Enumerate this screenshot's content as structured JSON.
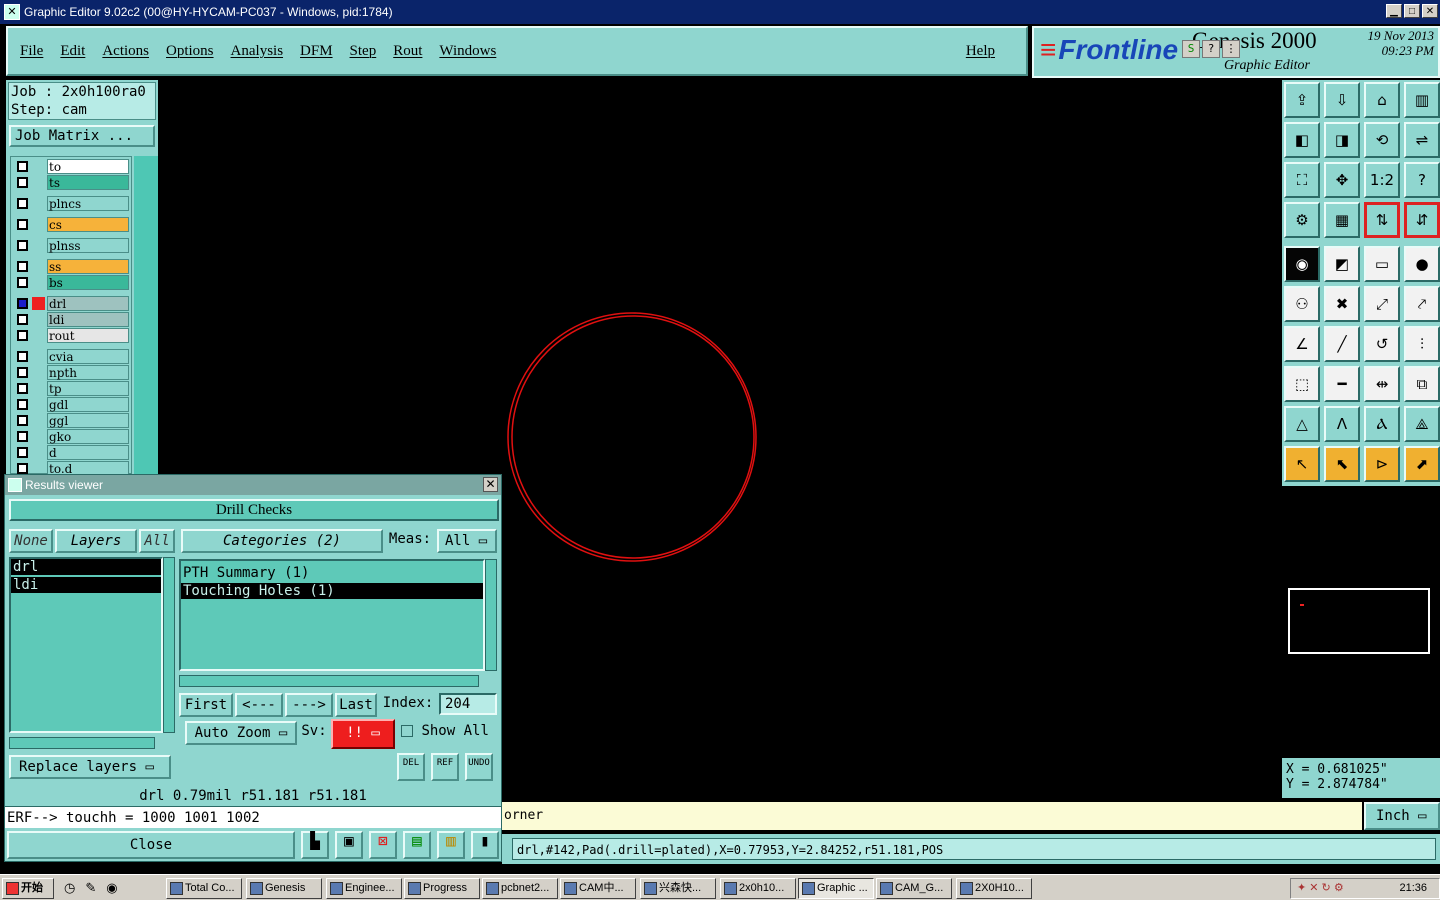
{
  "window": {
    "title": "Graphic Editor 9.02c2 (00@HY-HYCAM-PC037 - Windows, pid:1784)",
    "min": "▁",
    "max": "□",
    "close": "✕"
  },
  "menu": {
    "items": [
      "File",
      "Edit",
      "Actions",
      "Options",
      "Analysis",
      "DFM",
      "Step",
      "Rout",
      "Windows"
    ],
    "help": "Help"
  },
  "logo": {
    "brand": "Frontline",
    "product": "Genesis 2000",
    "subtitle": "Graphic Editor",
    "date": "19 Nov 2013",
    "time": "09:23 PM",
    "mini_buttons": [
      "S",
      "?",
      "⋮"
    ]
  },
  "job": {
    "job_line": "Job : 2x0h100ra0",
    "step_line": "Step: cam",
    "matrix_button": "Job Matrix ..."
  },
  "layers": [
    {
      "name": "to",
      "color": "#ffffff"
    },
    {
      "name": "ts",
      "color": "#3ab89a"
    },
    {
      "name": "plncs",
      "color": "#8fd6cf"
    },
    {
      "name": "cs",
      "color": "#f6b23a"
    },
    {
      "name": "plnss",
      "color": "#8fd6cf"
    },
    {
      "name": "ss",
      "color": "#f6b23a"
    },
    {
      "name": "bs",
      "color": "#3ab89a"
    },
    {
      "name": "drl",
      "color": "#9ec2bf"
    },
    {
      "name": "ldi",
      "color": "#9ec2bf"
    },
    {
      "name": "rout",
      "color": "#e6e6e6"
    },
    {
      "name": "cvia",
      "color": "#8fd6cf"
    },
    {
      "name": "npth",
      "color": "#8fd6cf"
    },
    {
      "name": "tp",
      "color": "#8fd6cf"
    },
    {
      "name": "gdl",
      "color": "#8fd6cf"
    },
    {
      "name": "ggl",
      "color": "#8fd6cf"
    },
    {
      "name": "gko",
      "color": "#8fd6cf"
    },
    {
      "name": "d",
      "color": "#8fd6cf"
    },
    {
      "name": "to.d",
      "color": "#8fd6cf"
    }
  ],
  "toolbar_icons": [
    "⇪",
    "⇩",
    "⌂",
    "▥",
    "◧",
    "◨",
    "⟲",
    "⇌",
    "⛶",
    "✥",
    "1:2",
    "?",
    "⚙",
    "▦",
    "⇅",
    "⇵",
    "◉",
    "◩",
    "▭",
    "●",
    "⚇",
    "✖",
    "⤢",
    "⤤",
    "∠",
    "╱",
    "↺",
    "⫶",
    "⬚",
    "━",
    "⇹",
    "⧉",
    "△",
    "Ʌ",
    "Ⲁ",
    "⟁",
    "↖",
    "⬉",
    "⊳",
    "⬈"
  ],
  "coords": {
    "x": "X = 0.681025\"",
    "y": "Y = 2.874784\""
  },
  "results": {
    "title": "Results viewer",
    "heading": "Drill Checks",
    "btn_none": "None",
    "btn_layers": "Layers",
    "btn_all": "All",
    "btn_categories": "Categories (2)",
    "meas_label": "Meas:",
    "meas_value": "All",
    "layer_items": [
      "drl",
      "ldi"
    ],
    "category_items": [
      "PTH Summary (1)",
      "Touching Holes (1)"
    ],
    "nav": {
      "first": "First",
      "prev": "<---",
      "next": "--->",
      "last": "Last",
      "index_label": "Index:",
      "index_value": "204"
    },
    "auto_zoom": "Auto Zoom",
    "sv_label": "Sv:",
    "sv_value": "!!",
    "show_all": "Show All",
    "replace_layers": "Replace layers",
    "icons": [
      "DEL",
      "REF",
      "UNDO"
    ],
    "status": "drl 0.79mil r51.181 r51.181",
    "erf": "ERF--> touchh = 1000 1001 1002",
    "close": "Close"
  },
  "command_text": "orner",
  "units": "Inch",
  "info": "drl,#142,Pad(.drill=plated),X=0.77953,Y=2.84252,r51.181,POS",
  "taskbar": {
    "start": "开始",
    "tasks": [
      "Total Co...",
      "Genesis",
      "Enginee...",
      "Progress",
      "pcbnet2...",
      "CAM中...",
      "兴森快...",
      "2x0h10...",
      "Graphic ...",
      "CAM_G...",
      "2X0H10..."
    ],
    "clock": "21:36"
  },
  "colors": {
    "panel": "#8fd6cf",
    "circle": "#e01010",
    "accent": "#1846b8"
  }
}
